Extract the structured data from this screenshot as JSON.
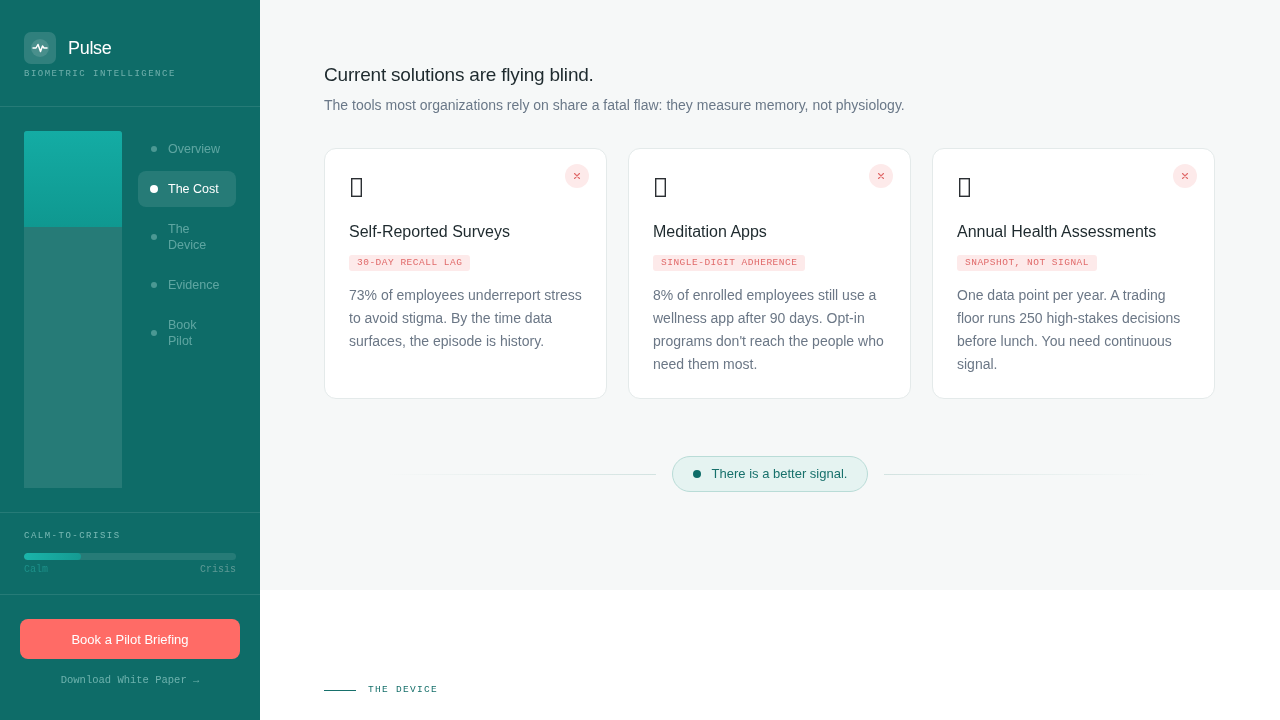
{
  "sidebar": {
    "brand": {
      "name": "Pulse",
      "tagline": "BIOMETRIC INTELLIGENCE"
    },
    "progress": {
      "level": 0.27
    },
    "nav_items": [
      {
        "label": "Overview",
        "selected": false
      },
      {
        "label": "The Cost",
        "selected": true
      },
      {
        "label": "The Device",
        "selected": false
      },
      {
        "label": "Evidence",
        "selected": false
      },
      {
        "label": "Book Pilot",
        "selected": false
      }
    ],
    "meter": {
      "title": "CALM-TO-CRISIS",
      "level": 0.27,
      "min_label": "Calm",
      "max_label": "Crisis"
    },
    "cta_button": "Book a Pilot Briefing",
    "secondary_link": "Download White Paper →"
  },
  "main": {
    "title": "Current solutions are flying blind.",
    "subtitle": "The tools most organizations rely on share a fatal flaw: they measure memory, not physiology.",
    "cards": [
      {
        "title": "Self-Reported Surveys",
        "tag": "30-DAY RECALL LAG",
        "body": "73% of employees underreport stress to avoid stigma. By the time data surfaces, the episode is history."
      },
      {
        "title": "Meditation Apps",
        "tag": "SINGLE-DIGIT ADHERENCE",
        "body": "8% of enrolled employees still use a wellness app after 90 days. Opt-in programs don't reach the people who need them most."
      },
      {
        "title": "Annual Health Assessments",
        "tag": "SNAPSHOT, NOT SIGNAL",
        "body": "One data point per year. A trading floor runs 250 high-stakes decisions before lunch. You need continuous signal."
      }
    ],
    "callout": "There is a better signal.",
    "next_section": {
      "label": "THE DEVICE"
    }
  }
}
